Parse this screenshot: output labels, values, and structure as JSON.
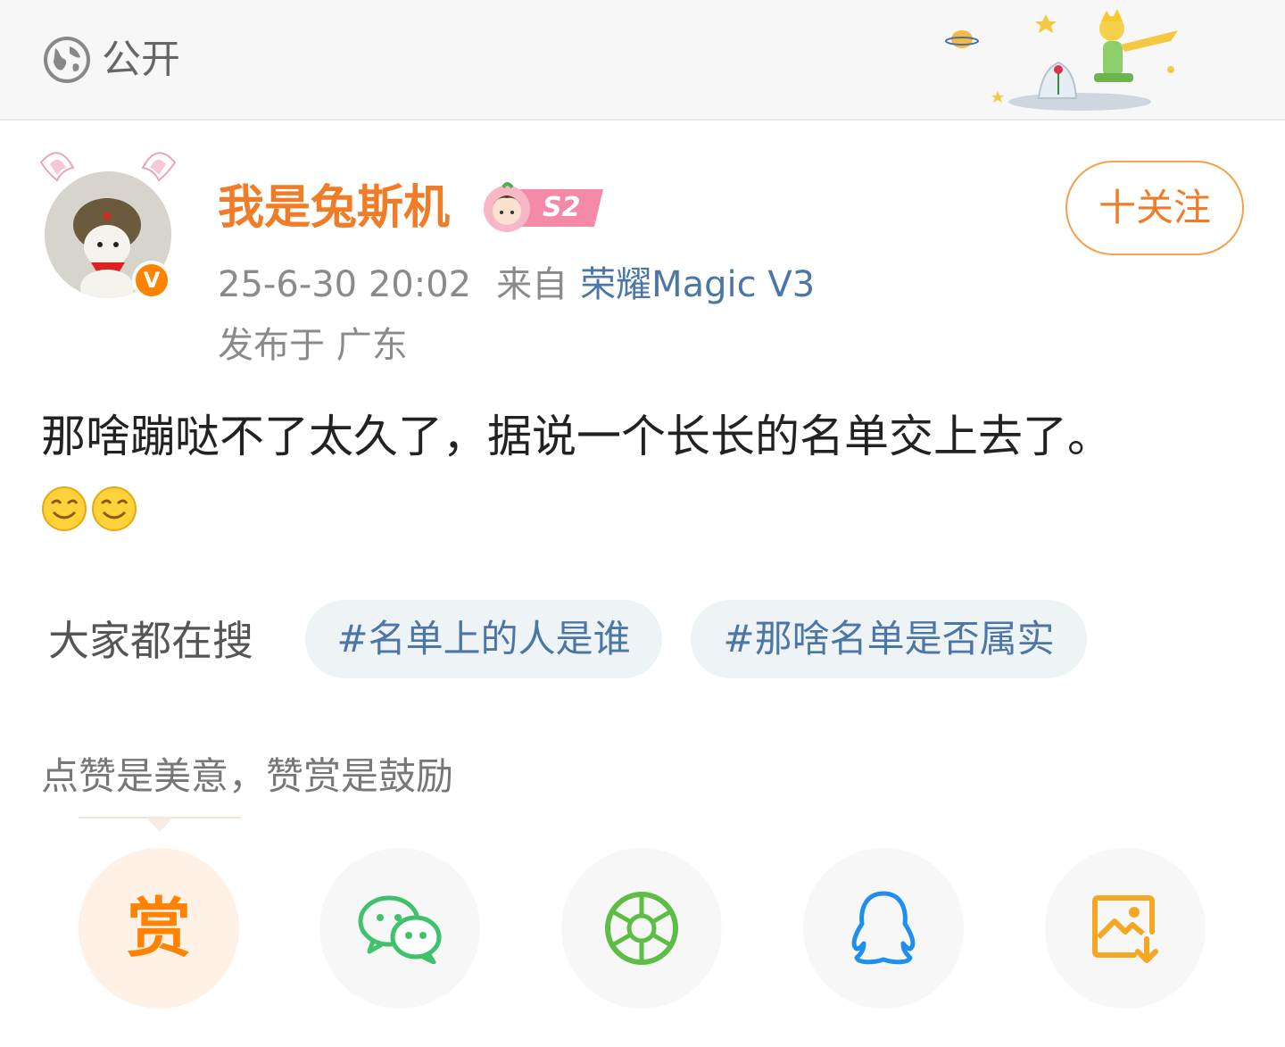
{
  "visibility": {
    "label": "公开",
    "icon": "globe-icon"
  },
  "user": {
    "name": "我是兔斯机",
    "level_badge": "S2",
    "verified_badge": "V",
    "follow_label": "十关注"
  },
  "meta": {
    "time": "25-6-30 20:02",
    "source_prefix": "来自",
    "device": "荣耀Magic V3",
    "location": "发布于 广东"
  },
  "post": {
    "text": "那啥蹦哒不了太久了，据说一个长长的名单交上去了。",
    "emojis": [
      "smile-emoji",
      "smile-emoji"
    ]
  },
  "search": {
    "title": "大家都在搜",
    "chips": [
      "#名单上的人是谁",
      "#那啥名单是否属实"
    ]
  },
  "reward": {
    "text": "点赞是美意，赞赏是鼓励",
    "button_glyph": "赏"
  },
  "share": {
    "items": [
      "reward-icon",
      "wechat-icon",
      "moments-icon",
      "qq-icon",
      "save-image-icon"
    ]
  },
  "colors": {
    "username": "#f07c28",
    "accent": "#ff8200",
    "link": "#4c76a6",
    "wechat": "#3fc26b",
    "qq": "#1e8ef0",
    "save": "#f5a623"
  }
}
